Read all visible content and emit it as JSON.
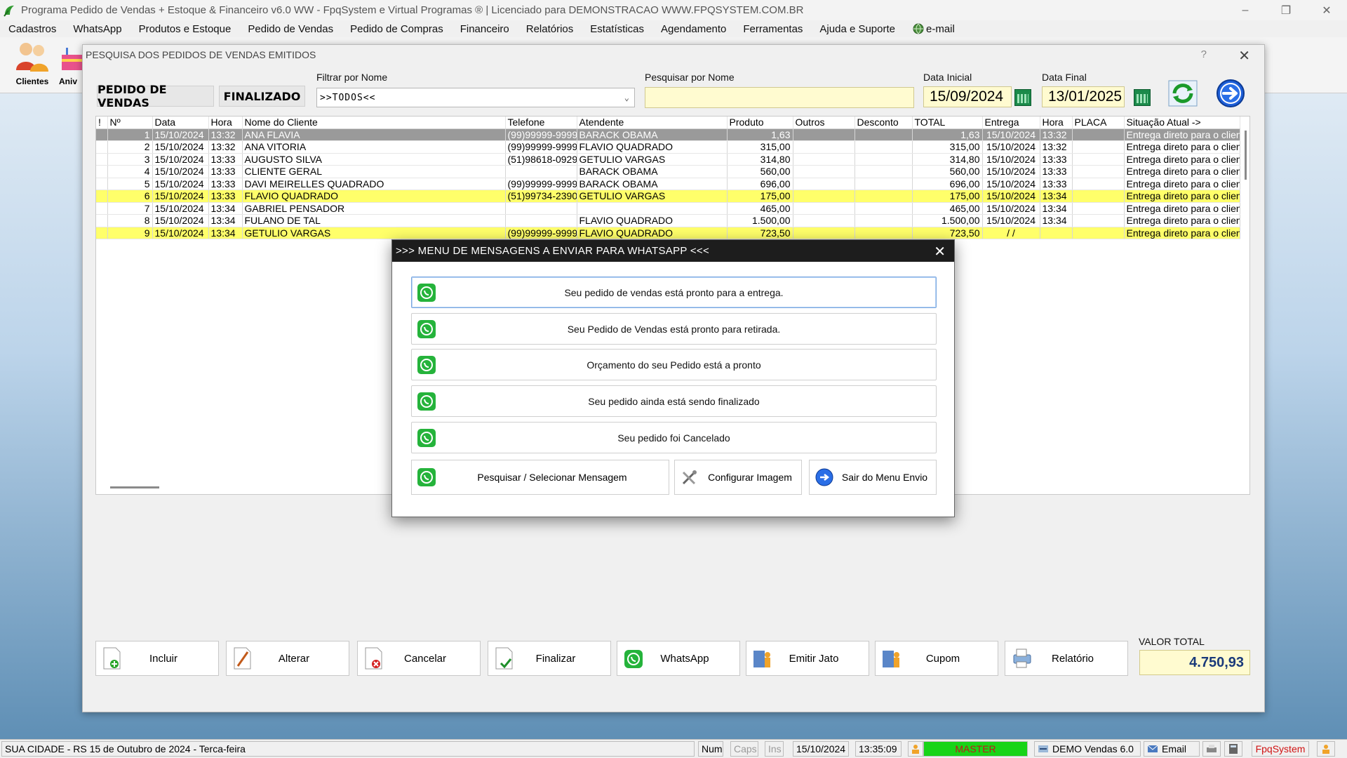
{
  "window": {
    "title": "Programa Pedido de Vendas + Estoque & Financeiro v6.0 WW - FpqSystem e Virtual Programas ® | Licenciado para  DEMONSTRACAO WWW.FPQSYSTEM.COM.BR"
  },
  "menu": [
    {
      "label": "Cadastros"
    },
    {
      "label": "WhatsApp"
    },
    {
      "label": "Produtos e Estoque"
    },
    {
      "label": "Pedido de Vendas"
    },
    {
      "label": "Pedido de Compras"
    },
    {
      "label": "Financeiro"
    },
    {
      "label": "Relatórios"
    },
    {
      "label": "Estatísticas"
    },
    {
      "label": "Agendamento"
    },
    {
      "label": "Ferramentas"
    },
    {
      "label": "Ajuda e Suporte"
    },
    {
      "label": "e-mail"
    }
  ],
  "toolbar": {
    "clientes": "Clientes",
    "aniv": "Aniv"
  },
  "search_window": {
    "title": "PESQUISA DOS PEDIDOS DE VENDAS EMITIDOS",
    "help": "?",
    "tag_pedido": "PEDIDO DE VENDAS",
    "tag_finalizado": "FINALIZADO",
    "filter_label": "Filtrar por Nome",
    "filter_value": ">>TODOS<<",
    "search_label": "Pesquisar por Nome",
    "search_value": "",
    "date_ini_label": "Data Inicial",
    "date_ini": "15/09/2024",
    "date_fim_label": "Data Final",
    "date_fim": "13/01/2025"
  },
  "grid": {
    "columns": [
      "!",
      "Nº",
      "Data",
      "Hora",
      "Nome do Cliente",
      "Telefone",
      "Atendente",
      "Produto",
      "Outros",
      "Desconto",
      "TOTAL",
      "Entrega",
      "Hora",
      "PLACA",
      "Situação Atual ->"
    ],
    "rows": [
      {
        "n": "1",
        "data": "15/10/2024",
        "hora": "13:32",
        "cliente": "ANA FLAVIA",
        "tel": "(99)99999-9999",
        "atendente": "BARACK OBAMA",
        "produto": "1,63",
        "outros": "",
        "desconto": "",
        "total": "1,63",
        "entrega": "15/10/2024",
        "hora2": "13:32",
        "placa": "",
        "situacao": "Entrega direto para o clien"
      },
      {
        "n": "2",
        "data": "15/10/2024",
        "hora": "13:32",
        "cliente": "ANA VITORIA",
        "tel": "(99)99999-9999",
        "atendente": "FLAVIO QUADRADO",
        "produto": "315,00",
        "outros": "",
        "desconto": "",
        "total": "315,00",
        "entrega": "15/10/2024",
        "hora2": "13:32",
        "placa": "",
        "situacao": "Entrega direto para o clien"
      },
      {
        "n": "3",
        "data": "15/10/2024",
        "hora": "13:33",
        "cliente": "AUGUSTO SILVA",
        "tel": "(51)98618-0929",
        "atendente": "GETULIO VARGAS",
        "produto": "314,80",
        "outros": "",
        "desconto": "",
        "total": "314,80",
        "entrega": "15/10/2024",
        "hora2": "13:33",
        "placa": "",
        "situacao": "Entrega direto para o clien"
      },
      {
        "n": "4",
        "data": "15/10/2024",
        "hora": "13:33",
        "cliente": "CLIENTE GERAL",
        "tel": "",
        "atendente": "BARACK OBAMA",
        "produto": "560,00",
        "outros": "",
        "desconto": "",
        "total": "560,00",
        "entrega": "15/10/2024",
        "hora2": "13:33",
        "placa": "",
        "situacao": "Entrega direto para o clien"
      },
      {
        "n": "5",
        "data": "15/10/2024",
        "hora": "13:33",
        "cliente": "DAVI MEIRELLES QUADRADO",
        "tel": "(99)99999-9999",
        "atendente": "BARACK OBAMA",
        "produto": "696,00",
        "outros": "",
        "desconto": "",
        "total": "696,00",
        "entrega": "15/10/2024",
        "hora2": "13:33",
        "placa": "",
        "situacao": "Entrega direto para o clien"
      },
      {
        "n": "6",
        "data": "15/10/2024",
        "hora": "13:33",
        "cliente": "FLAVIO QUADRADO",
        "tel": "(51)99734-2390",
        "atendente": "GETULIO VARGAS",
        "produto": "175,00",
        "outros": "",
        "desconto": "",
        "total": "175,00",
        "entrega": "15/10/2024",
        "hora2": "13:34",
        "placa": "",
        "situacao": "Entrega direto para o clien"
      },
      {
        "n": "7",
        "data": "15/10/2024",
        "hora": "13:34",
        "cliente": "GABRIEL PENSADOR",
        "tel": "",
        "atendente": "",
        "produto": "465,00",
        "outros": "",
        "desconto": "",
        "total": "465,00",
        "entrega": "15/10/2024",
        "hora2": "13:34",
        "placa": "",
        "situacao": "Entrega direto para o clien"
      },
      {
        "n": "8",
        "data": "15/10/2024",
        "hora": "13:34",
        "cliente": "FULANO DE TAL",
        "tel": "",
        "atendente": "FLAVIO QUADRADO",
        "produto": "1.500,00",
        "outros": "",
        "desconto": "",
        "total": "1.500,00",
        "entrega": "15/10/2024",
        "hora2": "13:34",
        "placa": "",
        "situacao": "Entrega direto para o clien"
      },
      {
        "n": "9",
        "data": "15/10/2024",
        "hora": "13:34",
        "cliente": "GETULIO VARGAS",
        "tel": "(99)99999-9999",
        "atendente": "FLAVIO QUADRADO",
        "produto": "723,50",
        "outros": "",
        "desconto": "",
        "total": "723,50",
        "entrega": "  /  /",
        "hora2": "",
        "placa": "",
        "situacao": "Entrega direto para o clien"
      }
    ]
  },
  "bottom_buttons": [
    {
      "label": "Incluir"
    },
    {
      "label": "Alterar"
    },
    {
      "label": "Cancelar"
    },
    {
      "label": "Finalizar"
    },
    {
      "label": "WhatsApp"
    },
    {
      "label": "Emitir Jato"
    },
    {
      "label": "Cupom"
    },
    {
      "label": "Relatório"
    }
  ],
  "valor_total": {
    "label": "VALOR TOTAL",
    "value": "4.750,93"
  },
  "modal": {
    "title": ">>> MENU DE MENSAGENS A ENVIAR PARA WHATSAPP <<<",
    "messages": [
      {
        "label": "Seu pedido de vendas está pronto para a entrega."
      },
      {
        "label": "Seu Pedido de Vendas está pronto para retirada."
      },
      {
        "label": "Orçamento do seu Pedido está a pronto"
      },
      {
        "label": "Seu pedido ainda está sendo finalizado"
      },
      {
        "label": "Seu pedido foi Cancelado"
      }
    ],
    "actions": {
      "pesquisar": "Pesquisar / Selecionar Mensagem",
      "configurar": "Configurar Imagem",
      "sair": "Sair do Menu Envio"
    }
  },
  "statusbar": {
    "city": "SUA CIDADE - RS 15 de Outubro de 2024 - Terca-feira",
    "num": "Num",
    "caps": "Caps",
    "ins": "Ins",
    "date": "15/10/2024",
    "time": "13:35:09",
    "user": "MASTER",
    "version": "DEMO Vendas 6.0",
    "email": "Email",
    "brand": "FpqSystem"
  },
  "colors": {
    "selected_row": "#9a9a9a",
    "highlight_row": "#ffff6a",
    "input_yellow": "#fffbd0",
    "whatsapp_green": "#25b33b",
    "master_green": "#18d418"
  }
}
